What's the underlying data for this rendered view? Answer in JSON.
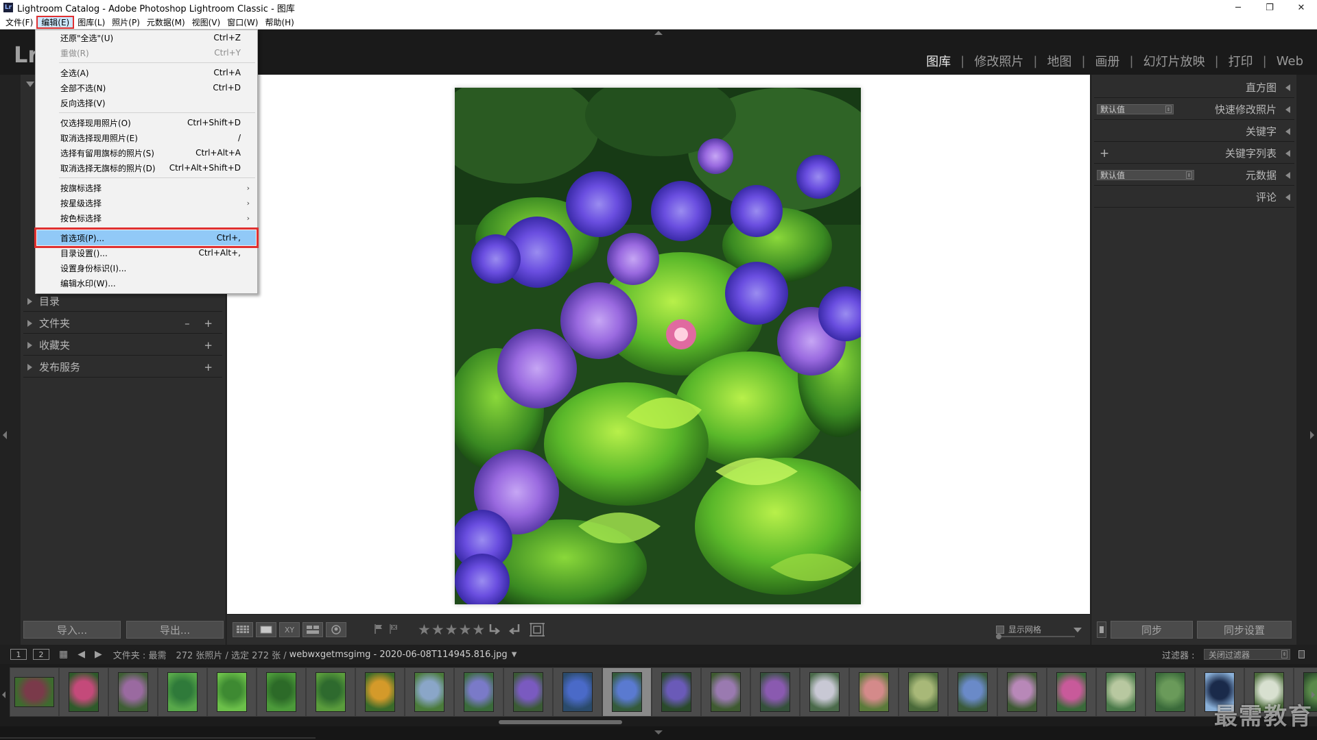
{
  "window": {
    "title": "Lightroom Catalog - Adobe Photoshop Lightroom Classic - 图库",
    "app_icon": "Lr",
    "controls": {
      "minimize": "─",
      "restore": "❐",
      "close": "✕"
    }
  },
  "menubar": {
    "items": [
      "文件(F)",
      "编辑(E)",
      "图库(L)",
      "照片(P)",
      "元数据(M)",
      "视图(V)",
      "窗口(W)",
      "帮助(H)"
    ],
    "active_index": 1
  },
  "edit_menu": {
    "items": [
      {
        "label": "还原\"全选\"(U)",
        "shortcut": "Ctrl+Z"
      },
      {
        "label": "重做(R)",
        "shortcut": "Ctrl+Y",
        "disabled": true
      },
      {
        "label": "全选(A)",
        "shortcut": "Ctrl+A"
      },
      {
        "label": "全部不选(N)",
        "shortcut": "Ctrl+D"
      },
      {
        "label": "反向选择(V)",
        "shortcut": ""
      },
      {
        "label": "仅选择现用照片(O)",
        "shortcut": "Ctrl+Shift+D"
      },
      {
        "label": "取消选择现用照片(E)",
        "shortcut": "/"
      },
      {
        "label": "选择有留用旗标的照片(S)",
        "shortcut": "Ctrl+Alt+A"
      },
      {
        "label": "取消选择无旗标的照片(D)",
        "shortcut": "Ctrl+Alt+Shift+D"
      },
      {
        "label": "按旗标选择",
        "submenu": "›"
      },
      {
        "label": "按星级选择",
        "submenu": "›"
      },
      {
        "label": "按色标选择",
        "submenu": "›"
      },
      {
        "label": "首选项(P)...",
        "shortcut": "Ctrl+,",
        "highlighted": true
      },
      {
        "label": "目录设置()...",
        "shortcut": "Ctrl+Alt+,"
      },
      {
        "label": "设置身份标识(I)...",
        "shortcut": ""
      },
      {
        "label": "编辑水印(W)...",
        "shortcut": ""
      }
    ]
  },
  "logo": "Lr",
  "modules": [
    "图库",
    "修改照片",
    "地图",
    "画册",
    "幻灯片放映",
    "打印",
    "Web"
  ],
  "module_separator": "|",
  "active_module": "图库",
  "left_panel": {
    "sections": [
      {
        "label": "目录",
        "actions": ""
      },
      {
        "label": "文件夹",
        "actions": "– +"
      },
      {
        "label": "收藏夹",
        "actions": "+"
      },
      {
        "label": "发布服务",
        "actions": "+"
      }
    ],
    "import_button": "导入...",
    "export_button": "导出..."
  },
  "right_panel": {
    "histogram": "直方图",
    "quick_develop": {
      "label": "快速修改照片",
      "preset": "默认值"
    },
    "keywording": "关键字",
    "keyword_list": {
      "label": "关键字列表",
      "add": "+"
    },
    "metadata": {
      "label": "元数据",
      "preset": "默认值"
    },
    "comments": "评论",
    "sync_button": "同步",
    "sync_settings_button": "同步设置"
  },
  "toolbar": {
    "view_icons": [
      "grid-view-icon",
      "loupe-view-icon",
      "compare-view-icon",
      "survey-view-icon",
      "people-view-icon"
    ],
    "compare_label": "XY",
    "stars": "★★★★★",
    "show_grid_label": "显示网格"
  },
  "filmstrip_header": {
    "page1": "1",
    "page2": "2",
    "source_prefix": "文件夹 : 最需",
    "count": "272 张照片 / 选定 272 张 /",
    "filename": "webwxgetmsgimg - 2020-06-08T114945.816.jpg",
    "filter_label": "过滤器 :",
    "filter_value": "关闭过滤器"
  },
  "filmstrip": {
    "thumb_colors": [
      [
        "#7a3a4a",
        "#3e6b2e"
      ],
      [
        "#c44a7a",
        "#2e5a2a"
      ],
      [
        "#9a6aa0",
        "#3e5e34"
      ],
      [
        "#2f7a3a",
        "#58a84a"
      ],
      [
        "#3e8a32",
        "#6cc04a"
      ],
      [
        "#2c6a28",
        "#4c9a3a"
      ],
      [
        "#2e6a2e",
        "#5a9c3c"
      ],
      [
        "#d49a2a",
        "#3a6a2a"
      ],
      [
        "#8aa6c8",
        "#4a7a3a"
      ],
      [
        "#7a7ac8",
        "#3a6a3a"
      ],
      [
        "#7a5ac0",
        "#3a5a34"
      ],
      [
        "#4a6ac8",
        "#2a4a6a"
      ],
      [
        "#5a7ad0",
        "#345a3a"
      ],
      [
        "#6a5ab8",
        "#2a4a2a"
      ],
      [
        "#9a7ab0",
        "#3e5a30"
      ],
      [
        "#8a5ab0",
        "#34503a"
      ],
      [
        "#c8c8d4",
        "#4a6a4a"
      ],
      [
        "#d48a8a",
        "#5a7a3a"
      ],
      [
        "#a8b878",
        "#4a6a3a"
      ],
      [
        "#6a8ac8",
        "#3a5a3a"
      ],
      [
        "#b888b8",
        "#3e5a34"
      ],
      [
        "#c85a9a",
        "#3a6a3a"
      ],
      [
        "#b8c8a0",
        "#4a7a4a"
      ],
      [
        "#6a9a5a",
        "#3a6a3a"
      ],
      [
        "#1a2a4a",
        "#8ab0d8"
      ],
      [
        "#d8e0d0",
        "#4a6a3a"
      ],
      [
        "#5a8a4a",
        "#2a4a2a"
      ]
    ],
    "selected_index": 12
  },
  "watermark": "最需教育"
}
